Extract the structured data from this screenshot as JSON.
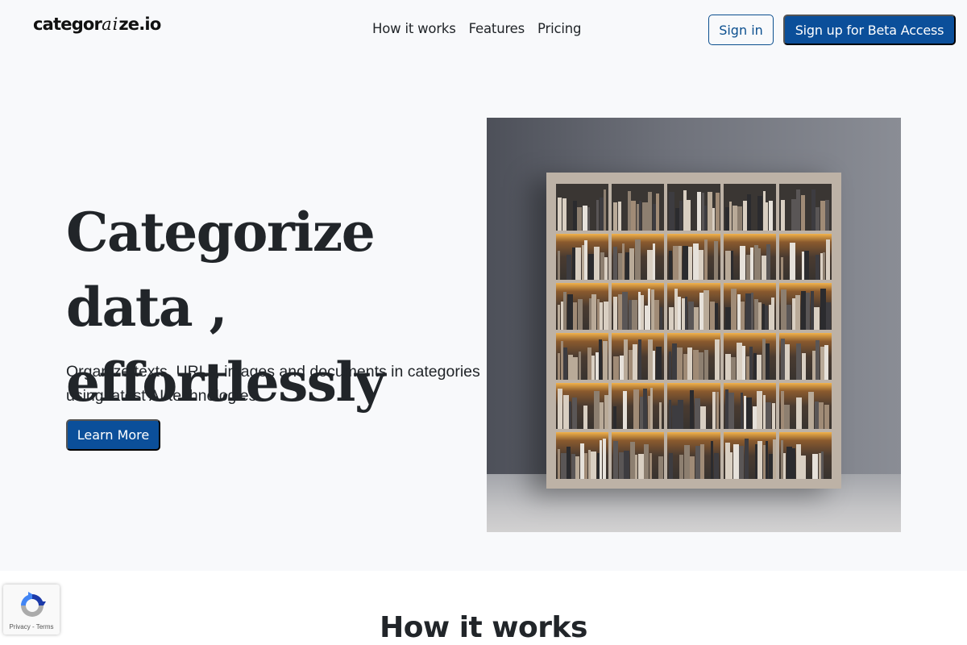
{
  "brand": {
    "logo_prefix": "categor",
    "logo_ai": "ai",
    "logo_suffix": "ze.io"
  },
  "nav": {
    "links": [
      "How it works",
      "Features",
      "Pricing"
    ],
    "sign_in_label": "Sign in",
    "sign_up_label": "Sign up for Beta Access"
  },
  "hero": {
    "title_line1": "Categorize data ,",
    "title_line2": "effortlessly",
    "subtitle": "Organize texts, URLs, images and documents in categories using latest AI technologies",
    "cta_label": "Learn More",
    "image_alt": "Illuminated bookshelf with books and vases"
  },
  "section": {
    "title": "How it works"
  },
  "recaptcha": {
    "links_text": "Privacy - Terms"
  },
  "colors": {
    "primary": "#0b4f9a",
    "background": "#f8f9fb",
    "text": "#212529"
  }
}
